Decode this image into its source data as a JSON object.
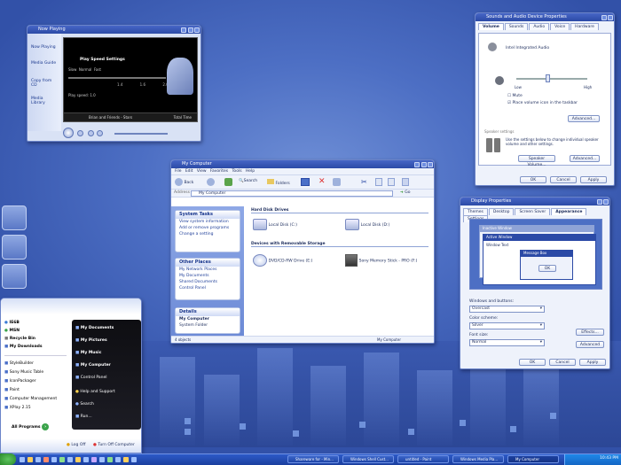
{
  "media": {
    "title": "Now Playing",
    "side": [
      "Now Playing",
      "Media Guide",
      "Copy from CD",
      "Media Library"
    ],
    "panel_title": "Play Speed Settings",
    "opts": [
      "Slow",
      "Normal",
      "Fast"
    ],
    "play_speed": "Play speed: 1.0",
    "ticks": [
      "1.4",
      "1.6",
      "2.0"
    ],
    "track": "Brian and Friends - Stars",
    "total": "Total Time"
  },
  "sound": {
    "title": "Sounds and Audio Device Properties",
    "tabs": [
      "Volume",
      "Sounds",
      "Audio",
      "Voice",
      "Hardware"
    ],
    "device": "Intel Integrated Audio",
    "low": "Low",
    "high": "High",
    "mute": "Mute",
    "place": "Place volume icon in the taskbar",
    "advanced": "Advanced...",
    "speaker_header": "Speaker settings",
    "speaker_text": "Use the settings below to change individual speaker volume and other settings.",
    "speaker_volume": "Speaker Volume...",
    "advanced2": "Advanced...",
    "ok": "OK",
    "cancel": "Cancel",
    "apply": "Apply"
  },
  "explorer": {
    "title": "My Computer",
    "menu": [
      "File",
      "Edit",
      "View",
      "Favorites",
      "Tools",
      "Help"
    ],
    "back": "Back",
    "search": "Search",
    "folders": "Folders",
    "address_label": "Address",
    "address": "My Computer",
    "go": "Go",
    "system_tasks": "System Tasks",
    "sys_items": [
      "View system information",
      "Add or remove programs",
      "Change a setting"
    ],
    "other_places": "Other Places",
    "other_items": [
      "My Network Places",
      "My Documents",
      "Shared Documents",
      "Control Panel"
    ],
    "details": "Details",
    "details_name": "My Computer",
    "details_sub": "System Folder",
    "hdd": "Hard Disk Drives",
    "disk1": "Local Disk (C:)",
    "disk2": "Local Disk (D:)",
    "removable": "Devices with Removable Storage",
    "dvd": "DVD/CD-RW Drive (E:)",
    "memstick": "Sony Memory Stick - PRO (F:)",
    "status_left": "4 objects",
    "status_right": "My Computer"
  },
  "display": {
    "title": "Display Properties",
    "tabs": [
      "Themes",
      "Desktop",
      "Screen Saver",
      "Appearance",
      "Settings"
    ],
    "preview_win": "Active Window",
    "preview_inactive": "Inactive Window",
    "preview_text": "Window Text",
    "msgbox": "Message Box",
    "msg_ok": "OK",
    "wb_label": "Windows and buttons:",
    "wb": "Overcast",
    "cs_label": "Color scheme:",
    "cs": "Silver",
    "fs_label": "Font size:",
    "fs": "Normal",
    "effects": "Effects...",
    "advanced": "Advanced",
    "ok": "OK",
    "cancel": "Cancel",
    "apply": "Apply"
  },
  "start": {
    "pinned": [
      "IE6B",
      "MSN",
      "Recycle Bin",
      "My Downloads"
    ],
    "recent": [
      "StyleBuilder",
      "Sony Music Table",
      "IconPackager",
      "Paint",
      "Computer Management",
      "XPlay 2.15"
    ],
    "all": "All Programs",
    "right": [
      "My Documents",
      "My Pictures",
      "My Music",
      "My Computer",
      "Control Panel",
      "Help and Support",
      "Search",
      "Run..."
    ],
    "logoff": "Log Off",
    "turnoff": "Turn Off Computer"
  },
  "taskbar": {
    "items": [
      "Shareware for - Min...",
      "Windows Shell Cust...",
      "untitled - Paint",
      "Windows Media Pla...",
      "My Computer"
    ],
    "clock": "10:43 PM"
  },
  "colors": {
    "accent": "#2b4aa6",
    "taskbar": "#1f46a8"
  }
}
